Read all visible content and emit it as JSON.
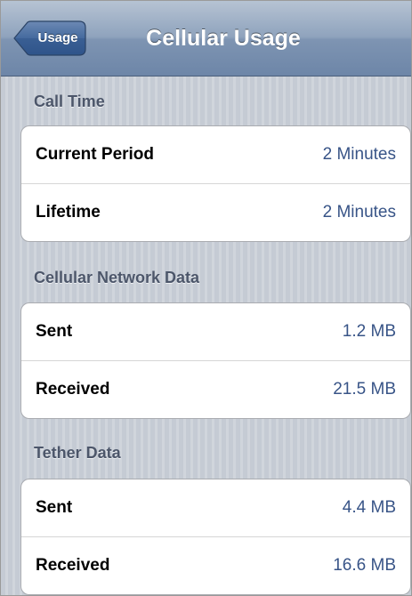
{
  "navbar": {
    "back_label": "Usage",
    "title": "Cellular Usage"
  },
  "sections": [
    {
      "header": "Call Time",
      "rows": [
        {
          "label": "Current Period",
          "value": "2 Minutes"
        },
        {
          "label": "Lifetime",
          "value": "2 Minutes"
        }
      ]
    },
    {
      "header": "Cellular Network Data",
      "rows": [
        {
          "label": "Sent",
          "value": "1.2 MB"
        },
        {
          "label": "Received",
          "value": "21.5 MB"
        }
      ]
    },
    {
      "header": "Tether Data",
      "rows": [
        {
          "label": "Sent",
          "value": "4.4 MB"
        },
        {
          "label": "Received",
          "value": "16.6 MB"
        }
      ]
    }
  ],
  "colors": {
    "value_text": "#385487",
    "navbar": "#8fa3bd",
    "section_header_text": "#4c566a"
  }
}
